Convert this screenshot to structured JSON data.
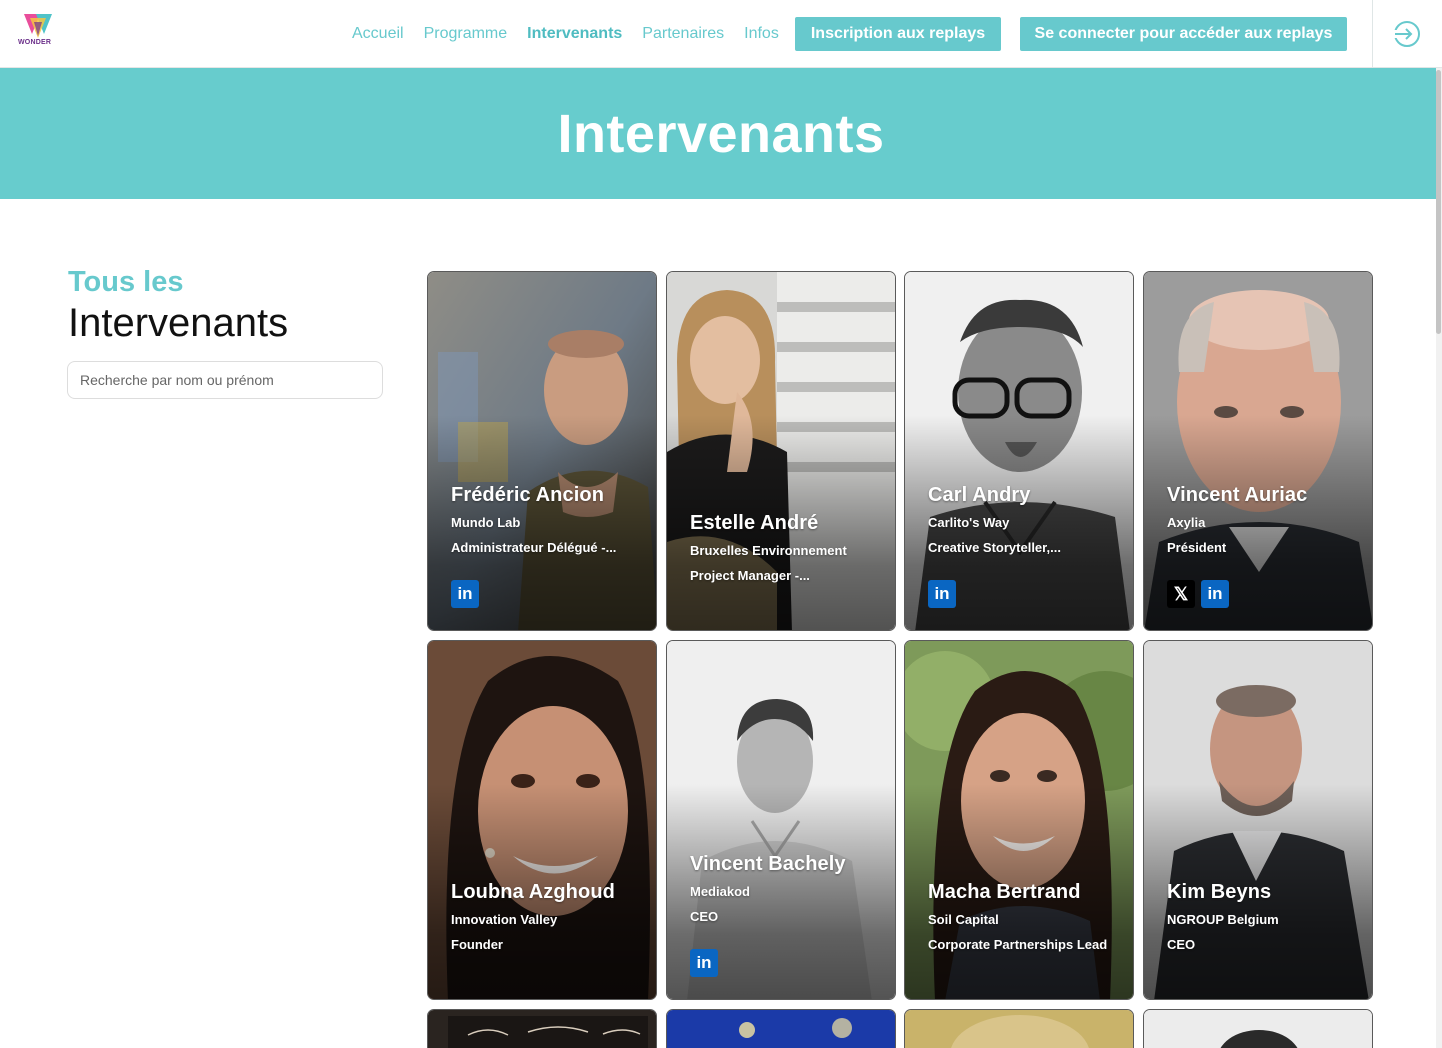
{
  "header": {
    "logo_text": "WONDER",
    "nav": [
      {
        "label": "Accueil",
        "active": false
      },
      {
        "label": "Programme",
        "active": false
      },
      {
        "label": "Intervenants",
        "active": true
      },
      {
        "label": "Partenaires",
        "active": false
      },
      {
        "label": "Infos",
        "active": false
      }
    ],
    "replay_button": "Inscription aux replays",
    "login_button": "Se connecter pour accéder aux replays",
    "login_icon": "login-arrow-icon"
  },
  "banner": {
    "title": "Intervenants"
  },
  "sidebar": {
    "kicker": "Tous les",
    "title": "Intervenants",
    "search_placeholder": "Recherche par nom ou prénom"
  },
  "speakers": [
    {
      "name": "Frédéric Ancion",
      "org": "Mundo Lab",
      "role": "Administrateur Délégué -...",
      "socials": [
        "linkedin"
      ]
    },
    {
      "name": "Estelle André",
      "org": "Bruxelles Environnement",
      "role": "Project Manager -...",
      "socials": []
    },
    {
      "name": "Carl Andry",
      "org": "Carlito's Way",
      "role": "Creative Storyteller,...",
      "socials": [
        "linkedin"
      ]
    },
    {
      "name": "Vincent Auriac",
      "org": "Axylia",
      "role": "Président",
      "socials": [
        "x",
        "linkedin"
      ]
    },
    {
      "name": "Loubna Azghoud",
      "org": "Innovation Valley",
      "role": "Founder",
      "socials": []
    },
    {
      "name": "Vincent Bachely",
      "org": "Mediakod",
      "role": "CEO",
      "socials": [
        "linkedin"
      ]
    },
    {
      "name": "Macha Bertrand",
      "org": "Soil Capital",
      "role": "Corporate Partnerships Lead",
      "socials": []
    },
    {
      "name": "Kim Beyns",
      "org": "NGROUP Belgium",
      "role": "CEO",
      "socials": []
    }
  ],
  "social_labels": {
    "linkedin": "in",
    "x": "𝕏"
  },
  "colors": {
    "accent": "#67c9cd",
    "banner": "#67cccd",
    "linkedin": "#0a66c2"
  }
}
